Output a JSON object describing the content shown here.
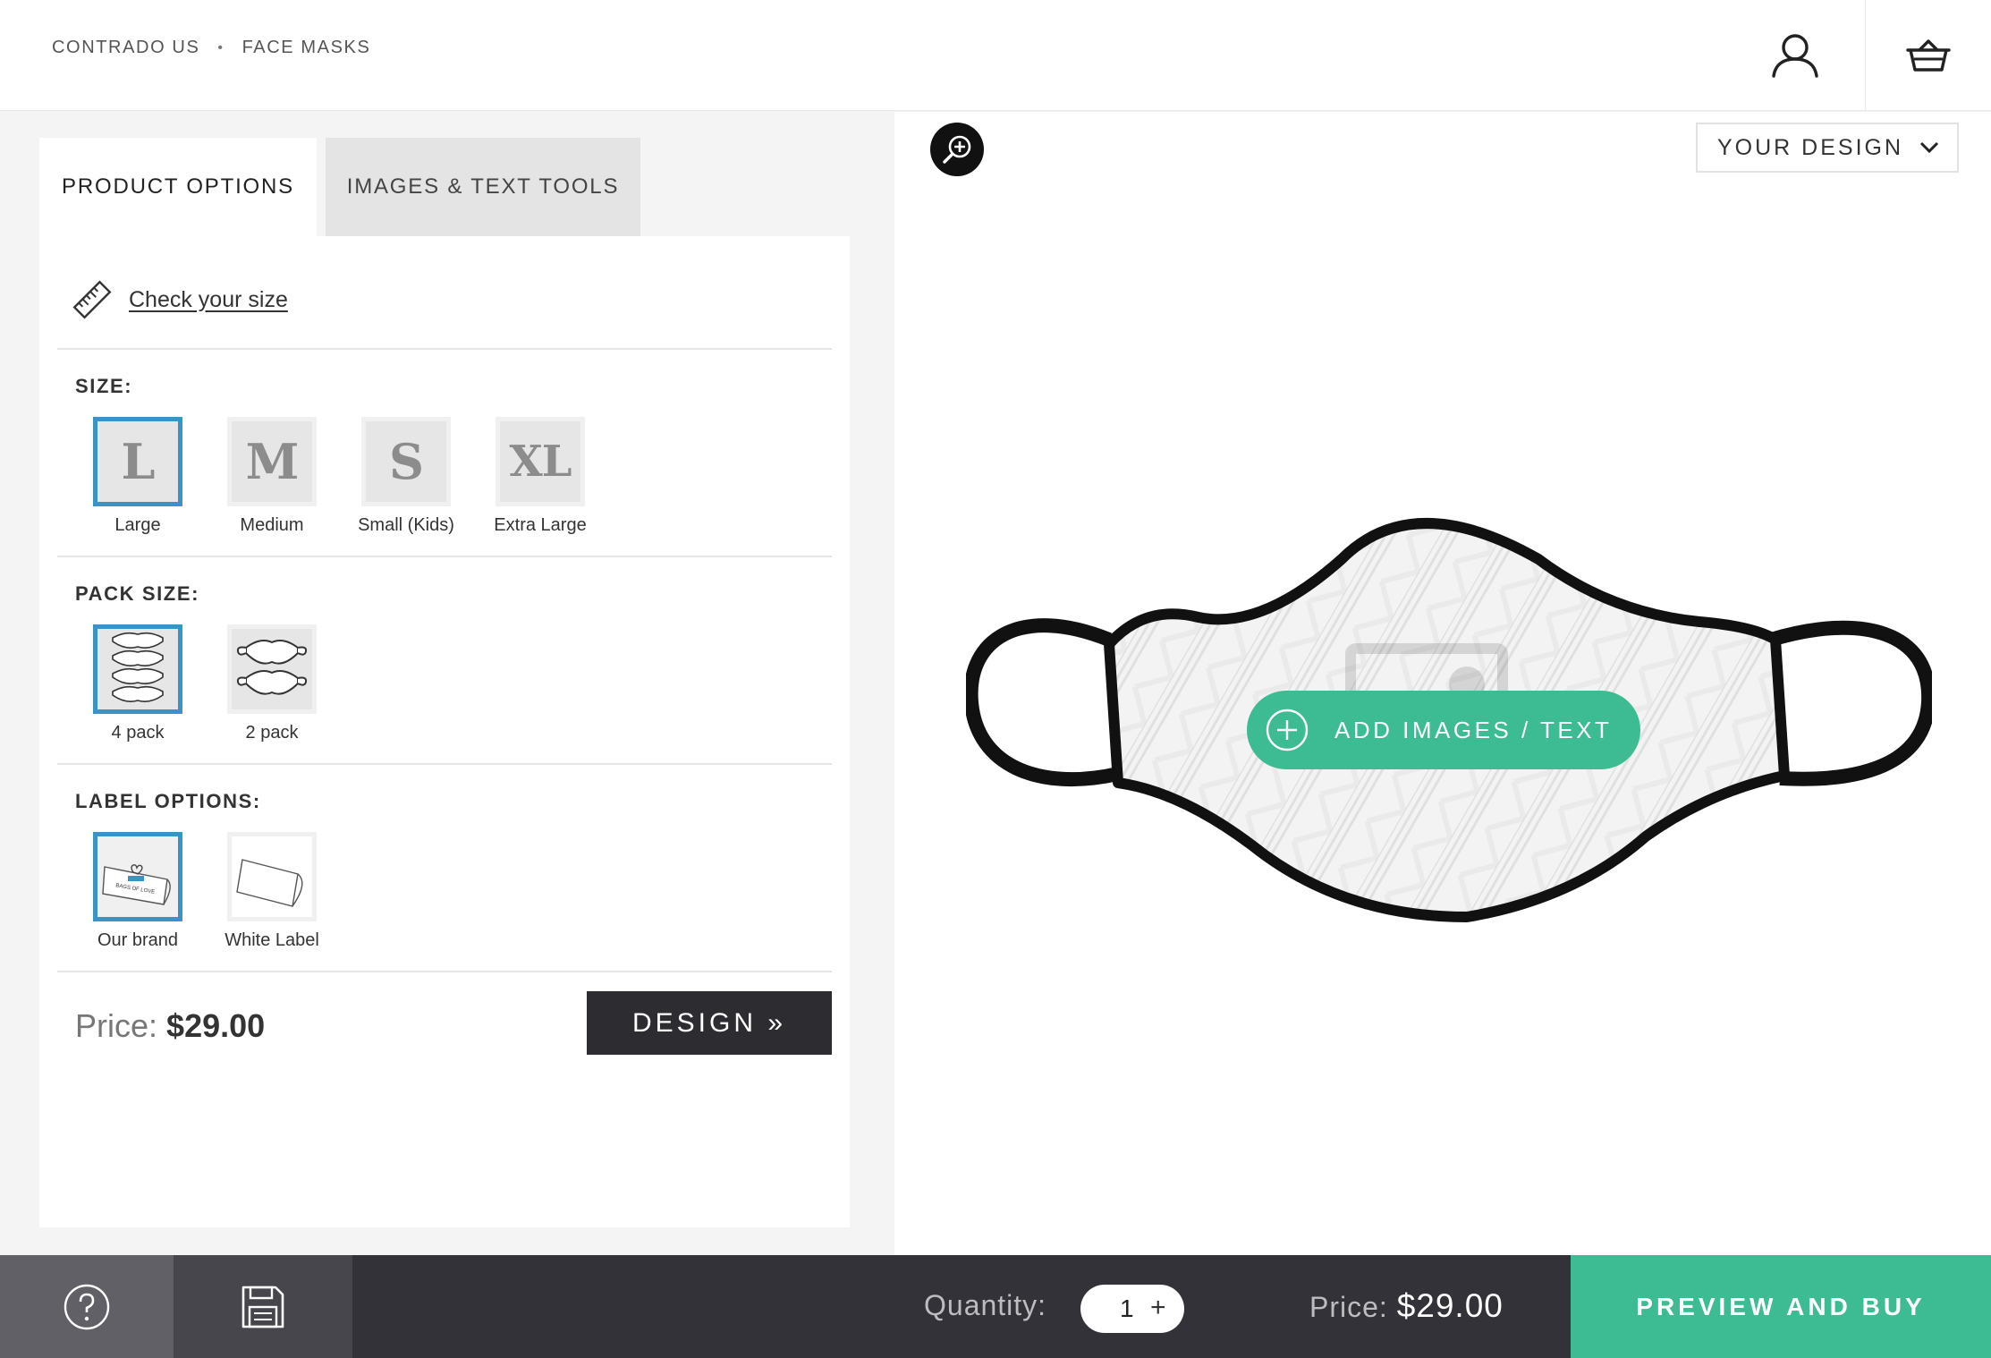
{
  "header": {
    "breadcrumb": [
      "CONTRADO US",
      "FACE MASKS"
    ],
    "breadcrumb_separator": "•",
    "account_icon": "user-icon",
    "basket_icon": "basket-icon"
  },
  "tabs": [
    {
      "label": "PRODUCT OPTIONS",
      "active": true
    },
    {
      "label": "IMAGES & TEXT TOOLS",
      "active": false
    }
  ],
  "size_guide": {
    "icon": "ruler-icon",
    "label": "Check your size"
  },
  "size": {
    "title": "SIZE:",
    "options": [
      {
        "glyph": "L",
        "label": "Large",
        "selected": true
      },
      {
        "glyph": "M",
        "label": "Medium",
        "selected": false
      },
      {
        "glyph": "S",
        "label": "Small (Kids)",
        "selected": false
      },
      {
        "glyph": "XL",
        "label": "Extra Large",
        "selected": false
      }
    ]
  },
  "pack_size": {
    "title": "PACK SIZE:",
    "options": [
      {
        "label": "4 pack",
        "selected": true
      },
      {
        "label": "2 pack",
        "selected": false
      }
    ]
  },
  "label_options": {
    "title": "LABEL OPTIONS:",
    "options": [
      {
        "label": "Our brand",
        "selected": true,
        "tag_text": "BAGS OF LOVE"
      },
      {
        "label": "White Label",
        "selected": false
      }
    ]
  },
  "panel_price": {
    "label": "Price:",
    "value": "$29.00"
  },
  "design_button": "DESIGN »",
  "canvas": {
    "view_select": "YOUR DESIGN",
    "zoom_icon": "zoom-in-icon",
    "add_button": "ADD IMAGES / TEXT"
  },
  "footer": {
    "help_icon": "help-icon",
    "save_icon": "save-icon",
    "quantity_label": "Quantity:",
    "quantity_value": "1",
    "quantity_plus": "+",
    "price_label": "Price:",
    "price_value": "$29.00",
    "buy_button": "PREVIEW AND BUY"
  },
  "colors": {
    "accent_green": "#3dbb92",
    "selected_blue": "#3a93c7",
    "footer_dark": "#323238"
  }
}
